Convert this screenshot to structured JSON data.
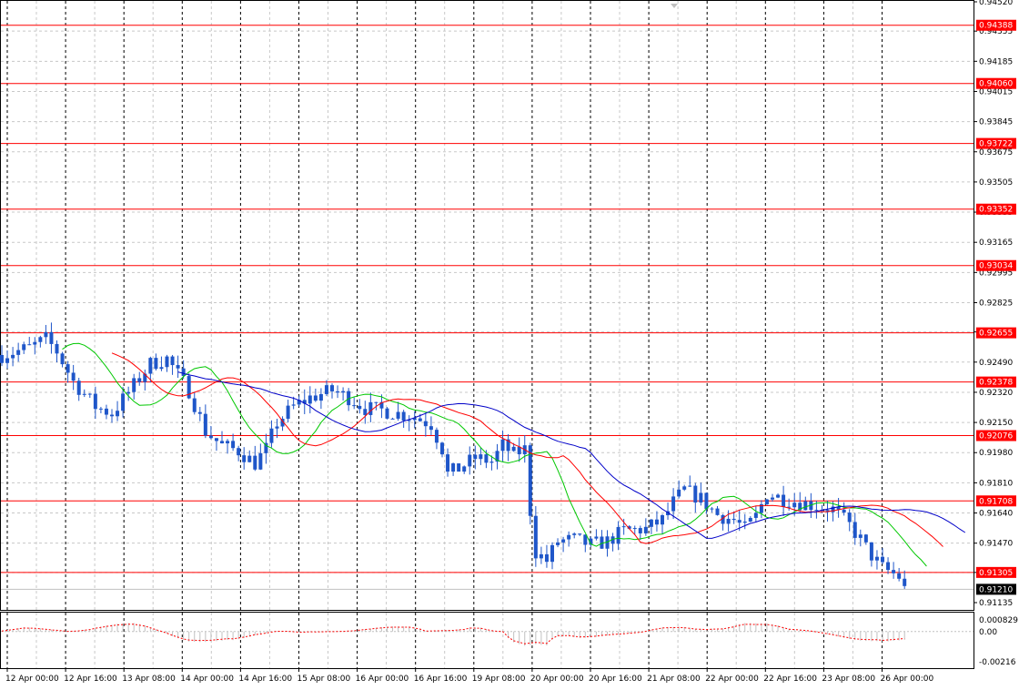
{
  "chart_data": {
    "type": "candlestick",
    "price_axis": {
      "ticks": [
        "0.94520",
        "0.94355",
        "0.94185",
        "0.94015",
        "0.93845",
        "0.93675",
        "0.93505",
        "0.93335",
        "0.93165",
        "0.92995",
        "0.92825",
        "0.92660",
        "0.92490",
        "0.92320",
        "0.92150",
        "0.91980",
        "0.91810",
        "0.91640",
        "0.91470",
        "0.91305",
        "0.91135"
      ],
      "ylim": [
        0.91135,
        0.9452
      ]
    },
    "time_axis": {
      "labels": [
        "12 Apr 00:00",
        "12 Apr 16:00",
        "13 Apr 08:00",
        "14 Apr 00:00",
        "14 Apr 16:00",
        "15 Apr 08:00",
        "16 Apr 00:00",
        "16 Apr 16:00",
        "19 Apr 08:00",
        "20 Apr 00:00",
        "20 Apr 16:00",
        "21 Apr 08:00",
        "22 Apr 00:00",
        "22 Apr 16:00",
        "23 Apr 08:00",
        "26 Apr 00:00"
      ]
    },
    "levels": [
      {
        "label": "0.94388",
        "value": 0.94388
      },
      {
        "label": "0.94060",
        "value": 0.9406
      },
      {
        "label": "0.93722",
        "value": 0.93722
      },
      {
        "label": "0.93352",
        "value": 0.93352
      },
      {
        "label": "0.93034",
        "value": 0.93034
      },
      {
        "label": "0.92655",
        "value": 0.92655
      },
      {
        "label": "0.92378",
        "value": 0.92378
      },
      {
        "label": "0.92076",
        "value": 0.92076
      },
      {
        "label": "0.91708",
        "value": 0.91708
      },
      {
        "label": "0.91305",
        "value": 0.91305
      }
    ],
    "current_price": {
      "label": "0.91210",
      "value": 0.9121
    },
    "price_path": [
      [
        0,
        0.9253
      ],
      [
        5,
        0.9257
      ],
      [
        8,
        0.9262
      ],
      [
        10,
        0.9255
      ],
      [
        13,
        0.9238
      ],
      [
        17,
        0.9224
      ],
      [
        20,
        0.922
      ],
      [
        24,
        0.9236
      ],
      [
        27,
        0.9248
      ],
      [
        30,
        0.9251
      ],
      [
        34,
        0.9233
      ],
      [
        37,
        0.921
      ],
      [
        40,
        0.9202
      ],
      [
        43,
        0.9199
      ],
      [
        46,
        0.9192
      ],
      [
        48,
        0.92
      ],
      [
        50,
        0.9215
      ],
      [
        53,
        0.9224
      ],
      [
        56,
        0.9229
      ],
      [
        60,
        0.9233
      ],
      [
        63,
        0.9229
      ],
      [
        66,
        0.9223
      ],
      [
        69,
        0.9222
      ],
      [
        72,
        0.922
      ],
      [
        75,
        0.9218
      ],
      [
        78,
        0.9214
      ],
      [
        80,
        0.92
      ],
      [
        81,
        0.9186
      ],
      [
        83,
        0.9189
      ],
      [
        86,
        0.9195
      ],
      [
        89,
        0.9193
      ],
      [
        91,
        0.9202
      ],
      [
        93,
        0.9197
      ],
      [
        95,
        0.92
      ],
      [
        96,
        0.9165
      ],
      [
        97,
        0.9142
      ],
      [
        99,
        0.9137
      ],
      [
        101,
        0.9148
      ],
      [
        104,
        0.9149
      ],
      [
        107,
        0.9146
      ],
      [
        110,
        0.9148
      ],
      [
        113,
        0.9154
      ],
      [
        117,
        0.9155
      ],
      [
        120,
        0.916
      ],
      [
        122,
        0.917
      ],
      [
        124,
        0.9177
      ],
      [
        127,
        0.9172
      ],
      [
        130,
        0.9163
      ],
      [
        133,
        0.916
      ],
      [
        135,
        0.9155
      ],
      [
        137,
        0.9162
      ],
      [
        139,
        0.9175
      ],
      [
        142,
        0.9172
      ],
      [
        145,
        0.917
      ],
      [
        148,
        0.9168
      ],
      [
        151,
        0.9166
      ],
      [
        154,
        0.9157
      ],
      [
        156,
        0.9149
      ],
      [
        158,
        0.914
      ],
      [
        160,
        0.9133
      ],
      [
        163,
        0.9128
      ],
      [
        164,
        0.9121
      ]
    ],
    "series": [
      {
        "color": "#00c800",
        "period": 8
      },
      {
        "color": "#ff0000",
        "period": 14
      },
      {
        "color": "#0000c8",
        "period": 22
      }
    ],
    "oscillator": {
      "ticks": [
        "0.000829",
        "0.00",
        "-0.00216"
      ],
      "ylim": [
        -0.00216,
        0.000829
      ]
    }
  },
  "colors": {
    "candle": "#1f56c9",
    "level_line": "#ff0000",
    "level_label_bg": "#ff0000",
    "current_label_bg": "#000000",
    "grid": "#c8c8c8",
    "separator": "#000000",
    "histogram": "#c0c0c0",
    "signal": "#ff0000"
  }
}
